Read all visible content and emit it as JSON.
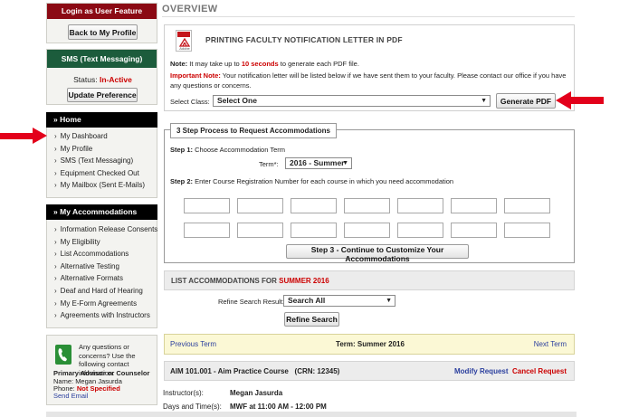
{
  "sidebar": {
    "login_header": "Login as User Feature",
    "back_button": "Back to My Profile",
    "sms_header": "SMS (Text Messaging)",
    "status_label": "Status:",
    "status_value": "In-Active",
    "update_button": "Update Preference",
    "home_header": "Home",
    "home_items": [
      "My Dashboard",
      "My Profile",
      "SMS (Text Messaging)",
      "Equipment Checked Out",
      "My Mailbox (Sent E-Mails)"
    ],
    "accom_header": "My Accommodations",
    "accom_items": [
      "Information Release Consents",
      "My Eligibility",
      "List Accommodations",
      "Alternative Testing",
      "Alternative Formats",
      "Deaf and Hard of Hearing",
      "My E-Form Agreements",
      "Agreements with Instructors"
    ],
    "contact": {
      "question": "Any questions or concerns? Use the following contact information:",
      "role": "Primary Advisor or Counselor",
      "name_label": "Name:",
      "name_value": "Megan Jasurda",
      "phone_label": "Phone:",
      "phone_value": "Not Specified",
      "email_link": "Send Email"
    }
  },
  "main": {
    "title": "OVERVIEW",
    "pdf_icon_label": "Adobe",
    "pdf_title": "PRINTING FACULTY NOTIFICATION LETTER IN PDF",
    "note_label": "Note:",
    "note_pre": "It may take up to",
    "note_time": "10 seconds",
    "note_post": "to generate each PDF file.",
    "important_label": "Important Note:",
    "important_text": "Your notification letter will be listed below if we have sent them to your faculty. Please contact our office if you have any questions or concerns.",
    "select_class_label": "Select Class:",
    "select_class_value": "Select One",
    "generate_button": "Generate PDF",
    "step_process_legend": "3 Step Process to Request Accommodations",
    "step1_label": "Step 1:",
    "step1_text": "Choose Accommodation Term",
    "term_label": "Term*:",
    "term_value": "2016 - Summer",
    "step2_label": "Step 2:",
    "step2_text": "Enter Course Registration Number for each course in which you need accommodation",
    "step3_button": "Step 3 - Continue to Customize Your Accommodations",
    "list_title_pre": "LIST ACCOMMODATIONS FOR",
    "list_title_term": "SUMMER 2016",
    "refine_label": "Refine Search Result:",
    "refine_value": "Search All",
    "refine_button": "Refine Search",
    "prev_term": "Previous Term",
    "term_display": "Term: Summer 2016",
    "next_term": "Next Term",
    "course_title": "AIM 101.001 - Aim Practice Course",
    "course_crn": "(CRN: 12345)",
    "modify_link": "Modify Request",
    "cancel_link": "Cancel Request",
    "instructor_label": "Instructor(s):",
    "instructor_value": "Megan Jasurda",
    "days_label": "Days and Time(s):",
    "days_value": "MWF at 11:00 AM - 12:00 PM"
  },
  "colors": {
    "login_header": "#8b0a14",
    "sms_header": "#1c5c3c",
    "accent_red": "#c00000",
    "arrow": "#e3001b"
  }
}
